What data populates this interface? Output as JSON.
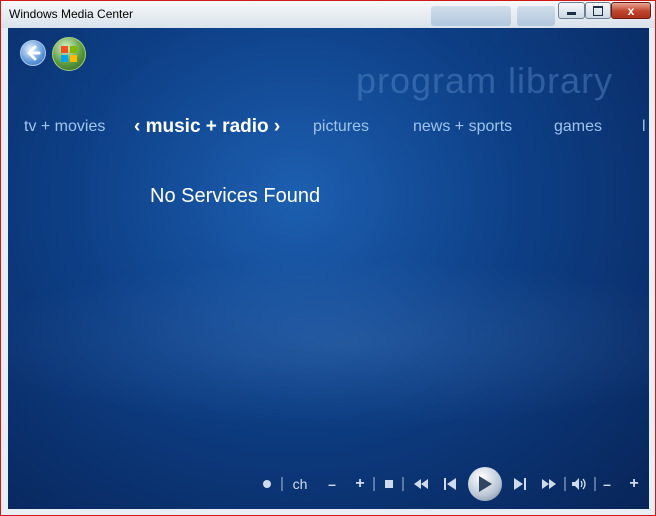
{
  "window": {
    "title": "Windows Media Center"
  },
  "titlebar": {
    "minimize_label": "—",
    "maximize_label": "□",
    "close_label": "x"
  },
  "nav": {
    "back_icon": "back-arrow-icon",
    "start_icon": "windows-logo-icon",
    "section_title": "program library"
  },
  "menu": {
    "tabs": [
      {
        "label": "tv + movies"
      },
      {
        "label": "music + radio",
        "left_arrow": "‹",
        "right_arrow": "›"
      },
      {
        "label": "pictures"
      },
      {
        "label": "news + sports"
      },
      {
        "label": "games"
      },
      {
        "label": "l"
      }
    ]
  },
  "content": {
    "message": "No Services Found"
  },
  "transport": {
    "record_icon": "record-icon",
    "channel_label": "ch",
    "channel_down_label": "–",
    "channel_up_label": "+",
    "stop_icon": "stop-icon",
    "rewind_icon": "rewind-icon",
    "previous_icon": "previous-track-icon",
    "play_icon": "play-icon",
    "next_icon": "next-track-icon",
    "fastforward_icon": "fast-forward-icon",
    "mute_icon": "volume-icon",
    "volume_down_label": "–",
    "volume_up_label": "+"
  },
  "colors": {
    "background": "#0d3f86",
    "active_text": "#ffffff",
    "inactive_text": "#9fc3ec",
    "close_button": "#c0442c"
  }
}
